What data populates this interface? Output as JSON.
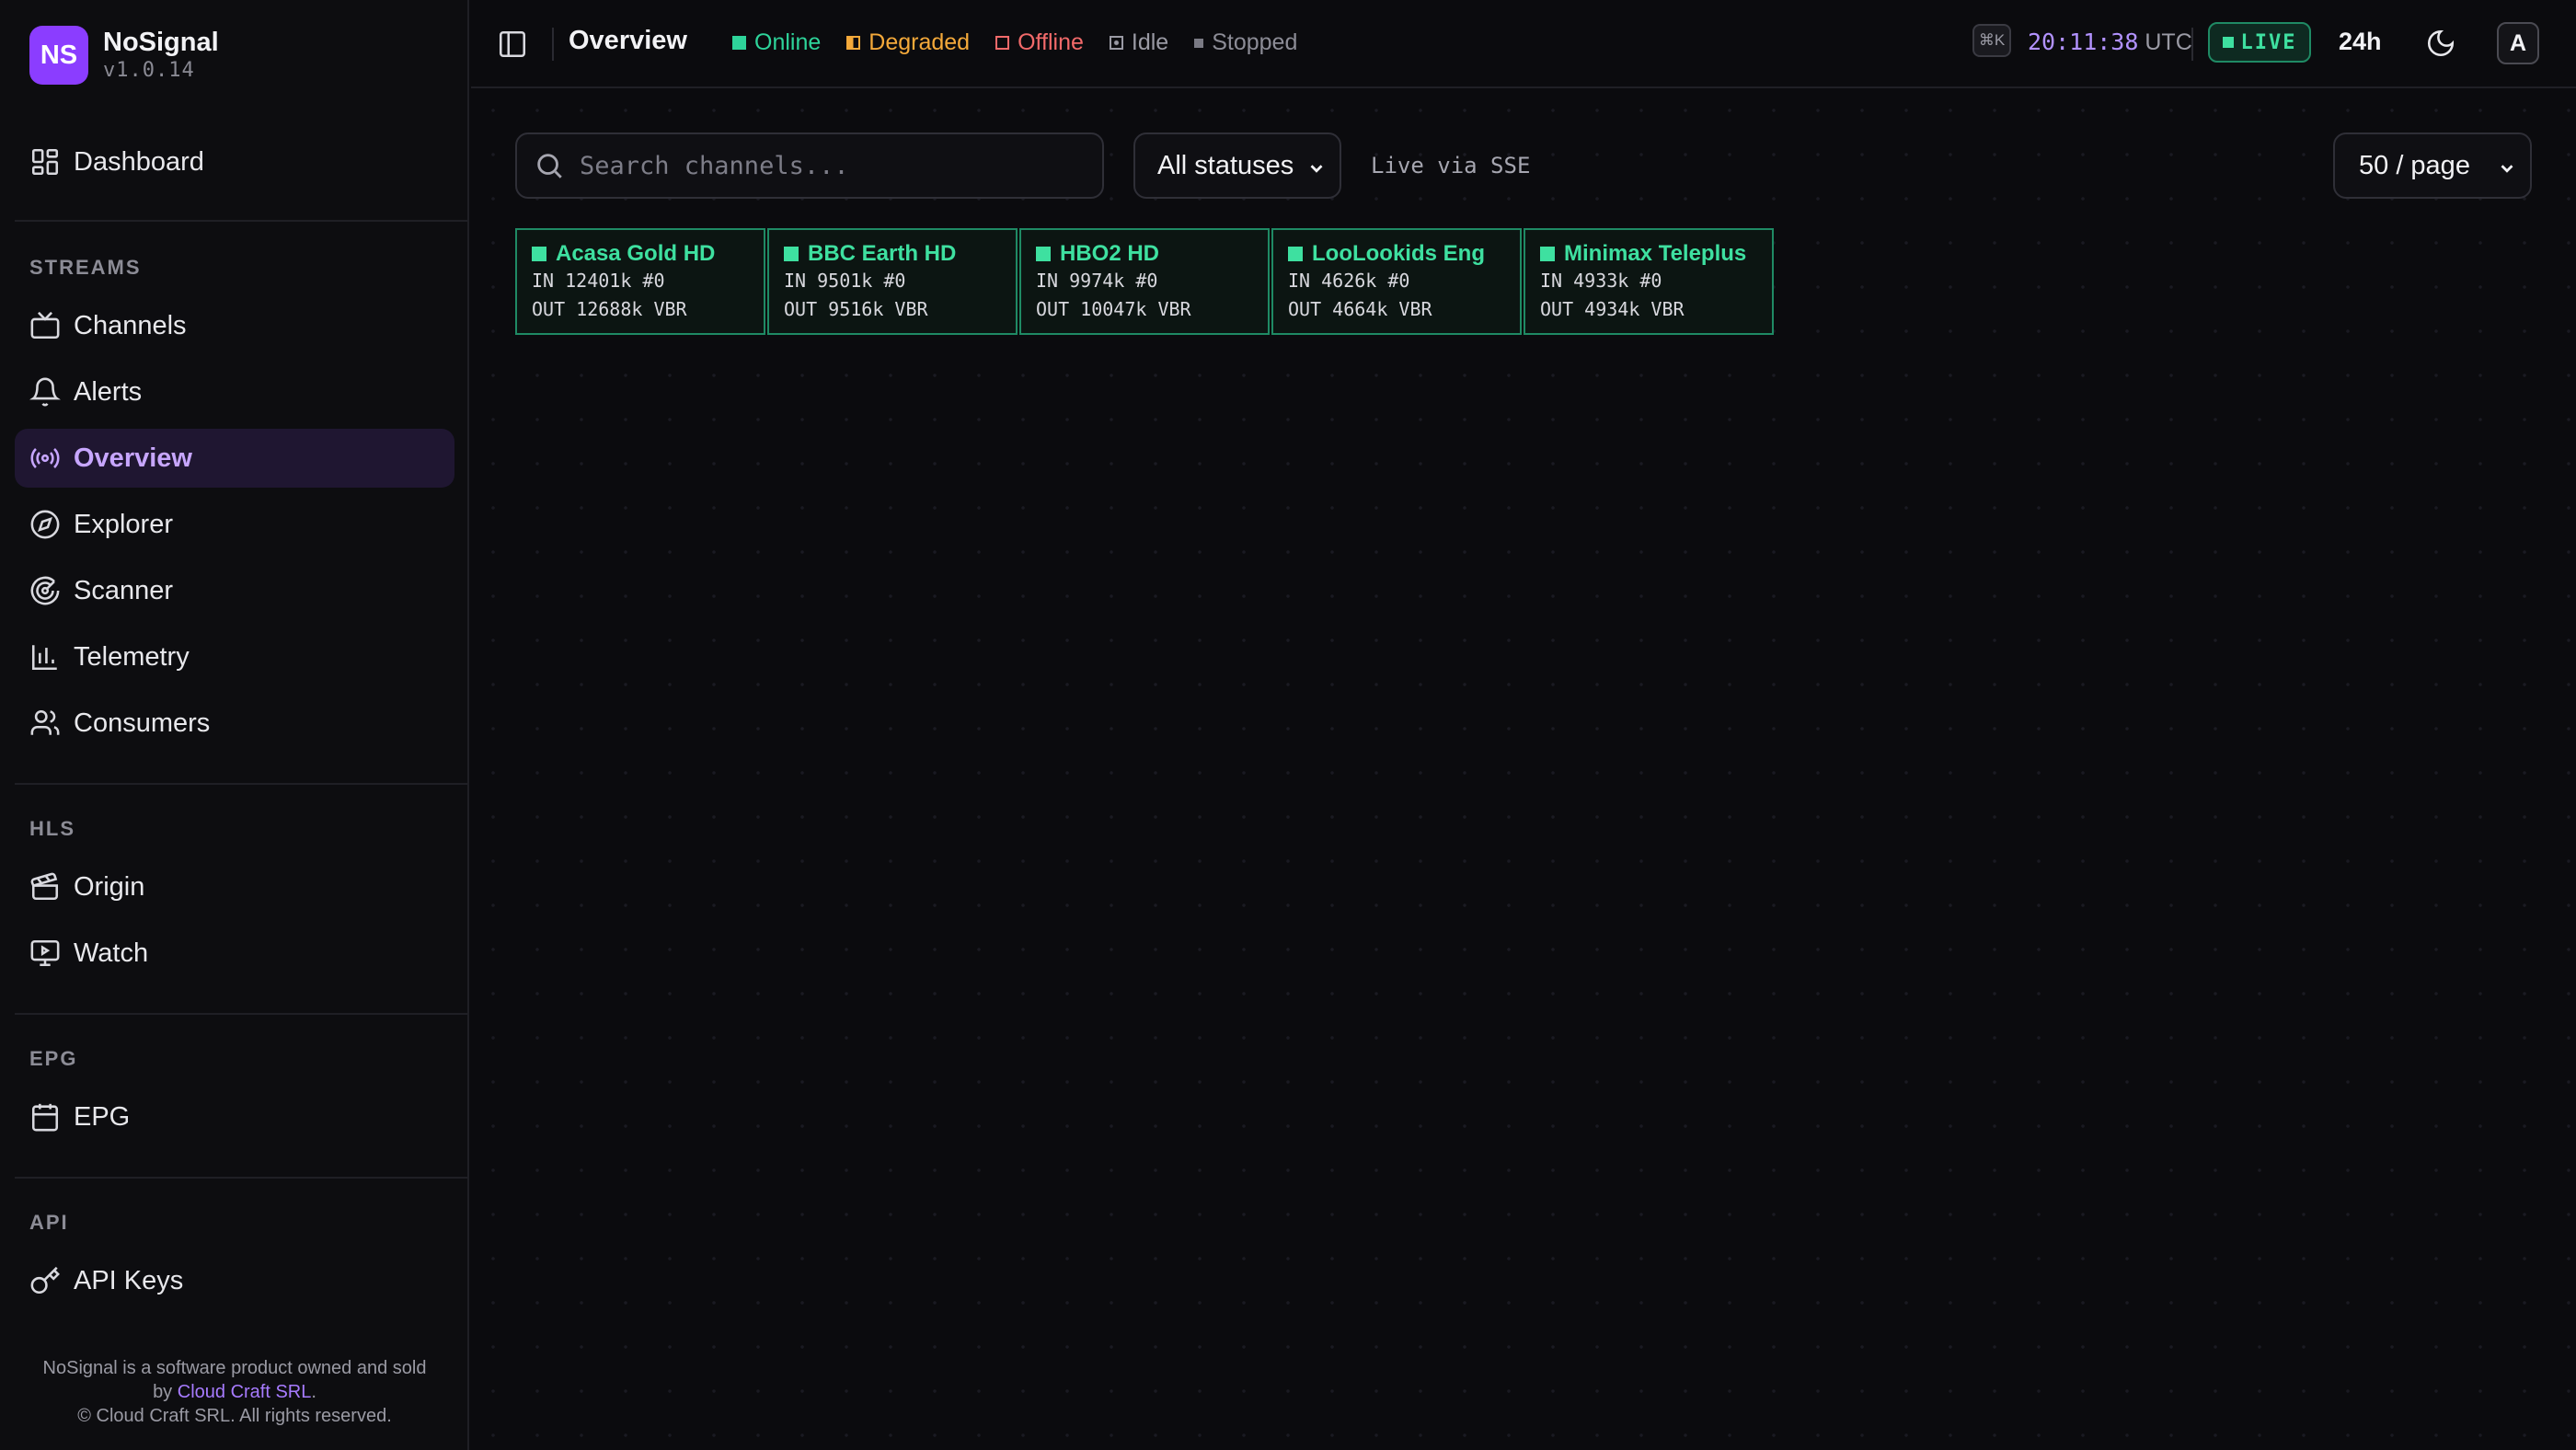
{
  "brand": {
    "logo_text": "NS",
    "name": "NoSignal",
    "version": "v1.0.14"
  },
  "sidebar": {
    "dashboard": {
      "label": "Dashboard",
      "icon": "dashboard-icon"
    },
    "sections": [
      {
        "title": "STREAMS",
        "items": [
          {
            "label": "Channels",
            "icon": "tv-icon"
          },
          {
            "label": "Alerts",
            "icon": "bell-icon"
          },
          {
            "label": "Overview",
            "icon": "broadcast-icon",
            "active": true
          },
          {
            "label": "Explorer",
            "icon": "compass-icon"
          },
          {
            "label": "Scanner",
            "icon": "radar-icon"
          },
          {
            "label": "Telemetry",
            "icon": "bar-chart-icon"
          },
          {
            "label": "Consumers",
            "icon": "users-icon"
          }
        ]
      },
      {
        "title": "HLS",
        "items": [
          {
            "label": "Origin",
            "icon": "clapperboard-icon"
          },
          {
            "label": "Watch",
            "icon": "monitor-play-icon"
          }
        ]
      },
      {
        "title": "EPG",
        "items": [
          {
            "label": "EPG",
            "icon": "calendar-icon"
          }
        ]
      },
      {
        "title": "API",
        "items": [
          {
            "label": "API Keys",
            "icon": "key-icon"
          }
        ]
      }
    ],
    "footer": {
      "line1_prefix": "NoSignal is a software product owned and sold",
      "line2_prefix": "by",
      "company_link": "Cloud Craft SRL",
      "line2_suffix": ".",
      "copyright": "© Cloud Craft SRL. All rights reserved."
    }
  },
  "header": {
    "title": "Overview",
    "legend": [
      {
        "label": "Online",
        "color": "#2ed49a",
        "style": "filled"
      },
      {
        "label": "Degraded",
        "color": "#f4a93a",
        "style": "half"
      },
      {
        "label": "Offline",
        "color": "#f26a6a",
        "style": "outline"
      },
      {
        "label": "Idle",
        "color": "#9a9aa4",
        "style": "outline-dot"
      },
      {
        "label": "Stopped",
        "color": "#7a7a84",
        "style": "small"
      }
    ],
    "shortcut": "⌘K",
    "time": "20:11:38",
    "timezone": "UTC",
    "live_label": "LIVE",
    "range": "24h",
    "avatar": "A"
  },
  "toolbar": {
    "search_placeholder": "Search channels...",
    "status_filter": "All statuses",
    "live_source": "Live via SSE",
    "page_size": "50 / page"
  },
  "channels": [
    {
      "name": "Acasa Gold HD",
      "in": "IN 12401k #0",
      "out": "OUT 12688k VBR",
      "status": "online"
    },
    {
      "name": "BBC Earth HD",
      "in": "IN 9501k #0",
      "out": "OUT 9516k VBR",
      "status": "online"
    },
    {
      "name": "HBO2 HD",
      "in": "IN 9974k #0",
      "out": "OUT 10047k VBR",
      "status": "online"
    },
    {
      "name": "LooLookids Eng",
      "in": "IN 4626k #0",
      "out": "OUT 4664k VBR",
      "status": "online"
    },
    {
      "name": "Minimax Teleplus",
      "in": "IN 4933k #0",
      "out": "OUT 4934k VBR",
      "status": "online"
    }
  ],
  "colors": {
    "accent": "#8b3dff",
    "online": "#3ee0a0",
    "active_text": "#c7a6ff"
  }
}
